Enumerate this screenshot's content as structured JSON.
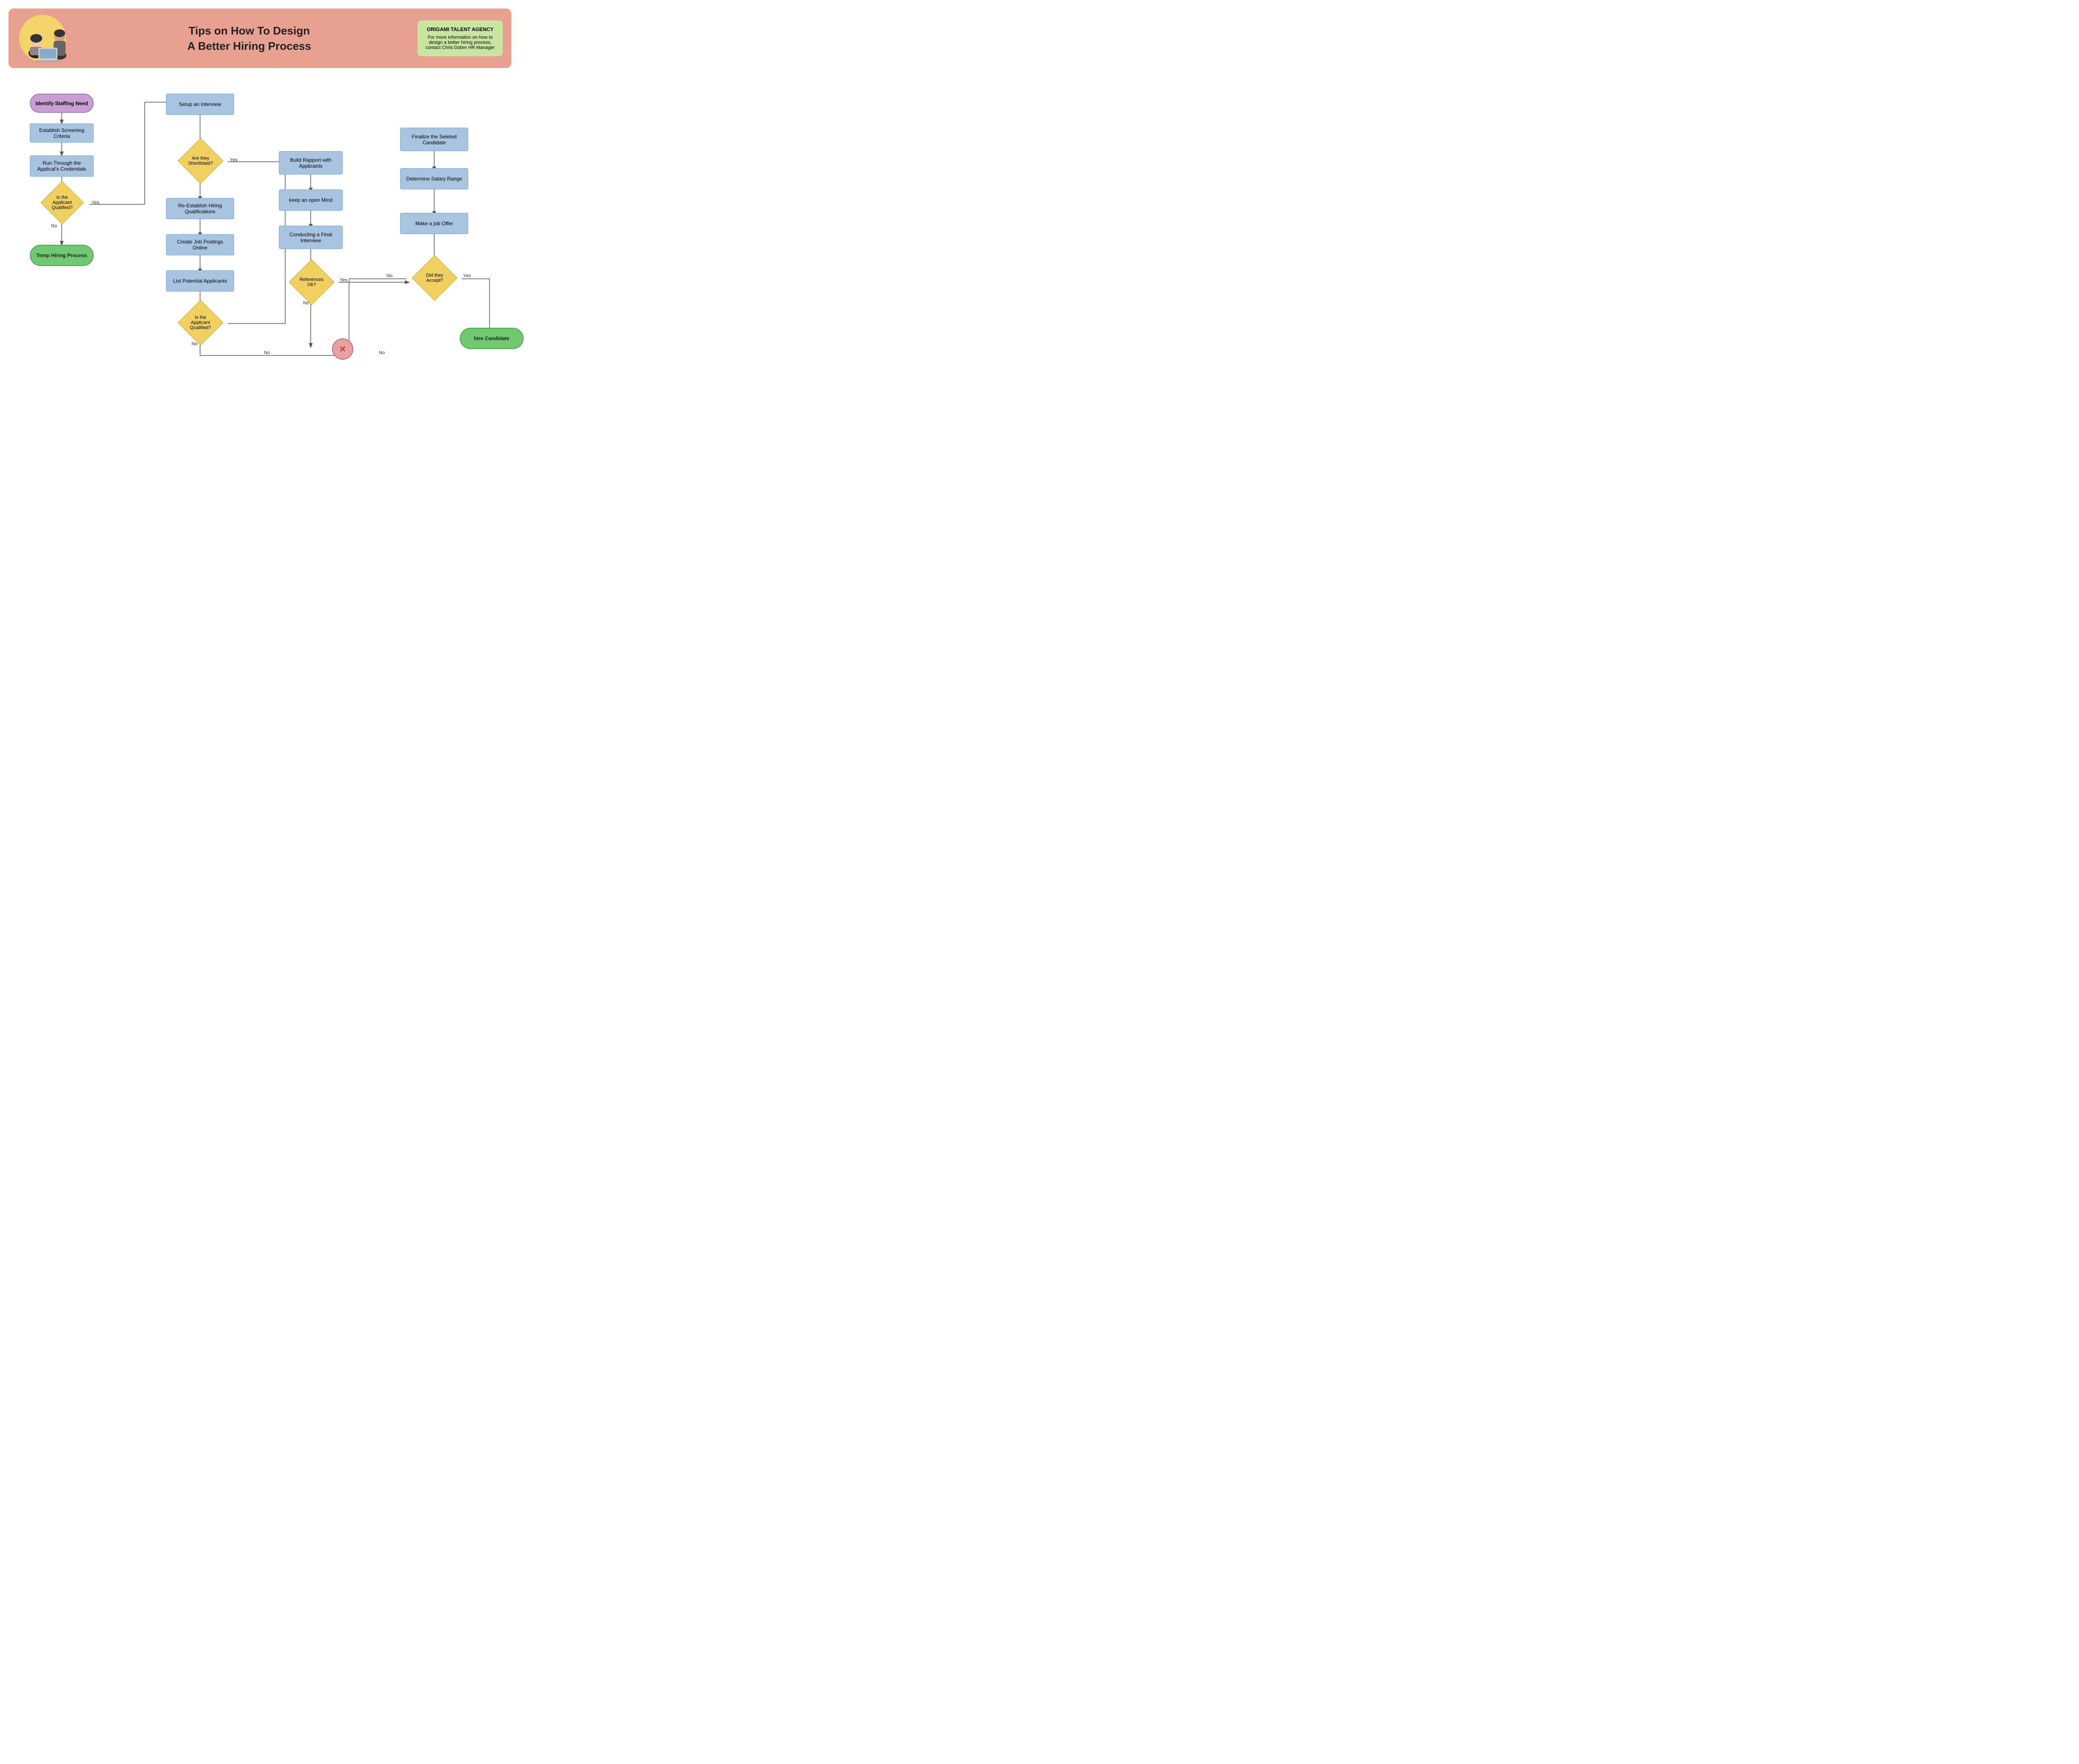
{
  "header": {
    "title_line1": "Tips on How To Design",
    "title_line2": "A Better Hiring Process",
    "info_box": {
      "company": "ORIGAMI TALENT AGENCY",
      "description": "For more information on how to design a better hiring process, contact Chris Dobre HR Manager"
    }
  },
  "flowchart": {
    "nodes": [
      {
        "id": "identify",
        "label": "Identify Staffing Need",
        "type": "oval-purple"
      },
      {
        "id": "screening",
        "label": "Establish Screening Criteria",
        "type": "rect"
      },
      {
        "id": "credentials",
        "label": "Run Through the Applicat's Credentials",
        "type": "rect"
      },
      {
        "id": "qualified1",
        "label": "Is the Applicant Qualified?",
        "type": "diamond"
      },
      {
        "id": "temp",
        "label": "Temp Hiring Process",
        "type": "oval-green"
      },
      {
        "id": "setup",
        "label": "Setup an Interview",
        "type": "rect"
      },
      {
        "id": "shortlisted",
        "label": "Are they Shortlisted?",
        "type": "diamond"
      },
      {
        "id": "reestablish",
        "label": "Re-Establish Hiring Qualifications",
        "type": "rect"
      },
      {
        "id": "postings",
        "label": "Create Job Postings Online",
        "type": "rect"
      },
      {
        "id": "list",
        "label": "List Potential Applicants",
        "type": "rect"
      },
      {
        "id": "qualified2",
        "label": "Is the Applicant Qualified?",
        "type": "diamond"
      },
      {
        "id": "rapport",
        "label": "Build Rapport with Applicants",
        "type": "rect"
      },
      {
        "id": "open_mind",
        "label": "keep an open Mind",
        "type": "rect"
      },
      {
        "id": "final_interview",
        "label": "Conducting a Final Interview",
        "type": "rect"
      },
      {
        "id": "references",
        "label": "References Ok?",
        "type": "diamond"
      },
      {
        "id": "finalize",
        "label": "Finalize the Seleted Candidate",
        "type": "rect"
      },
      {
        "id": "salary",
        "label": "Determine Salary Range",
        "type": "rect"
      },
      {
        "id": "offer",
        "label": "Make a job Offer",
        "type": "rect"
      },
      {
        "id": "accepted",
        "label": "Did they Accept?",
        "type": "diamond"
      },
      {
        "id": "hire",
        "label": "hire Candidate",
        "type": "oval-green"
      },
      {
        "id": "terminate",
        "label": "✕",
        "type": "x-circle"
      }
    ],
    "labels": {
      "yes": "Yes",
      "no": "No"
    }
  }
}
